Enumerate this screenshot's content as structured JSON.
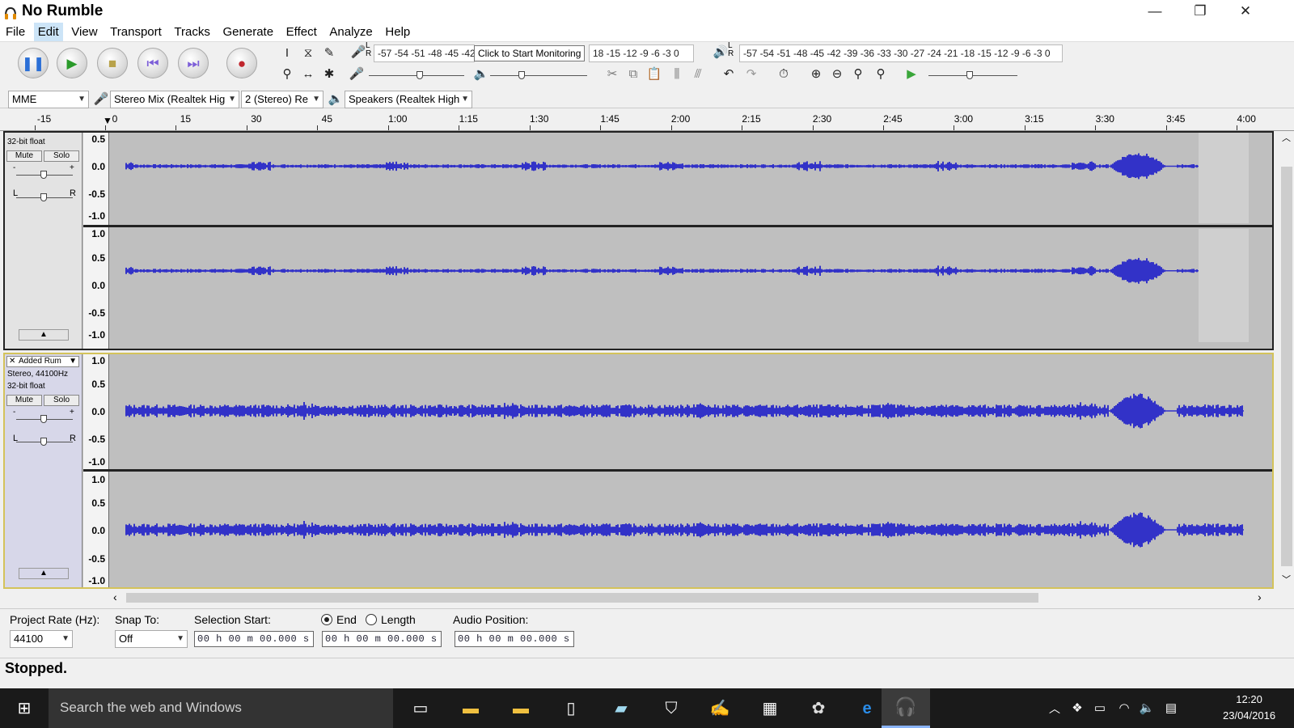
{
  "window": {
    "title": "No Rumble",
    "min": "—",
    "max": "❐",
    "close": "✕"
  },
  "menu": [
    "File",
    "Edit",
    "View",
    "Transport",
    "Tracks",
    "Generate",
    "Effect",
    "Analyze",
    "Help"
  ],
  "meters": {
    "record_scale": "-57 -54 -51 -48 -45 -42",
    "record_scale_right": "18 -15 -12  -9  -6  -3  0",
    "record_tooltip": "Click to Start Monitoring",
    "playback_scale": "-57 -54 -51 -48 -45 -42 -39 -36 -33 -30 -27 -24 -21 -18 -15 -12  -9  -6  -3  0",
    "lr_top": "L",
    "lr_bottom": "R"
  },
  "device": {
    "host": "MME",
    "recording_device": "Stereo Mix (Realtek Hig",
    "channels": "2 (Stereo) Re",
    "playback_device": "Speakers (Realtek High"
  },
  "ruler": [
    "-15",
    "0",
    "15",
    "30",
    "45",
    "1:00",
    "1:15",
    "1:30",
    "1:45",
    "2:00",
    "2:15",
    "2:30",
    "2:45",
    "3:00",
    "3:15",
    "3:30",
    "3:45",
    "4:00"
  ],
  "tracks": [
    {
      "name": "",
      "format": "32-bit float",
      "mute": "Mute",
      "solo": "Solo",
      "scale": [
        "0.5",
        "0.0",
        "-0.5",
        "-1.0",
        "1.0",
        "0.5",
        "0.0",
        "-0.5",
        "-1.0"
      ]
    },
    {
      "name": "Added Rum",
      "rate": "Stereo, 44100Hz",
      "format": "32-bit float",
      "mute": "Mute",
      "solo": "Solo",
      "scale": [
        "1.0",
        "0.5",
        "0.0",
        "-0.5",
        "-1.0",
        "1.0",
        "0.5",
        "0.0",
        "-0.5",
        "-1.0"
      ]
    }
  ],
  "selection": {
    "project_rate_label": "Project Rate (Hz):",
    "project_rate": "44100",
    "snap_label": "Snap To:",
    "snap": "Off",
    "start_label": "Selection Start:",
    "start": "00 h 00 m 00.000 s",
    "end_label": "End",
    "length_label": "Length",
    "end": "00 h 00 m 00.000 s",
    "audio_pos_label": "Audio Position:",
    "audio_pos": "00 h 00 m 00.000 s"
  },
  "status": "Stopped.",
  "taskbar": {
    "search": "Search the web and Windows",
    "time": "12:20",
    "date": "23/04/2016"
  },
  "colors": {
    "wave": "#3232c8",
    "track_bg": "#bfbfbf",
    "selected_border": "#d4c35a"
  }
}
